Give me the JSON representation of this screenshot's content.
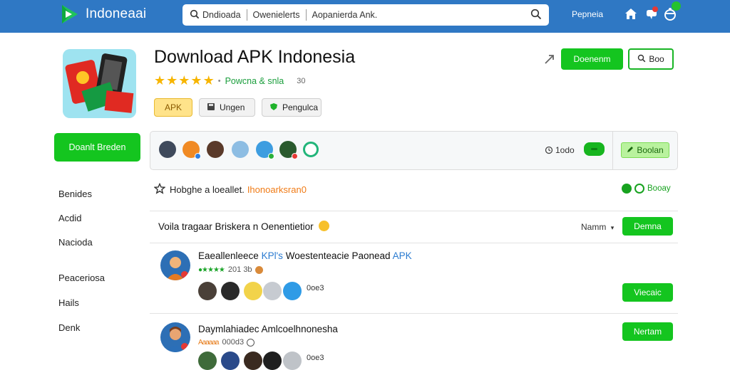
{
  "header": {
    "brand": "Indoneaai",
    "search_terms": [
      "Dndioada",
      "Owenielerts",
      "Aopanierda Ank."
    ],
    "nav_link": "Pepneia",
    "icons": [
      "home-icon",
      "notifications-icon",
      "cart-icon"
    ]
  },
  "app": {
    "title": "Download APK Indonesia",
    "stars": 5,
    "provider": "Powcna & snla",
    "rating_count": "30",
    "tags": [
      {
        "label": "APK"
      },
      {
        "label": "Ungen"
      },
      {
        "label": "Pengulca"
      }
    ],
    "download_button": "Doenenm",
    "secondary_button": "Boo"
  },
  "sidebar": {
    "cta": "Doanlt Breden",
    "items": [
      "Benides",
      "Acdid",
      "Nacioda",
      "Peaceriosa",
      "Hails",
      "Denk"
    ]
  },
  "avatar_panel": {
    "count": "1odo",
    "button": "Boolan"
  },
  "notice": {
    "text": "Hobghe a loeallet.",
    "highlight": "Ihonoarksran0",
    "status": "Booay"
  },
  "section": {
    "title": "Voila tragaar Briskera n Oenentietior",
    "sort_label": "Namm",
    "button": "Demna"
  },
  "reviews": [
    {
      "title": "Eaeallenleece",
      "title_highlight": "KPl's",
      "title_rest": "Woestenteacie Paonead",
      "title_tail": "APK",
      "stars_text": "●★★★★",
      "meta": "201 3b",
      "reactions_count": "0oe3",
      "button": "Viecaic"
    },
    {
      "title": "Daymlahiadec Amlcoelhnonesha",
      "title_highlight": "",
      "title_rest": "",
      "title_tail": "",
      "stars_text": "Aaaaaa",
      "meta": "000d3",
      "reactions_count": "0oe3",
      "button": "Nertam"
    }
  ],
  "colors": {
    "topbar": "#2f78c4",
    "accent_green": "#14c51f",
    "star": "#f7b500",
    "highlight_orange": "#f07b16",
    "link_blue": "#2b7bd0"
  }
}
